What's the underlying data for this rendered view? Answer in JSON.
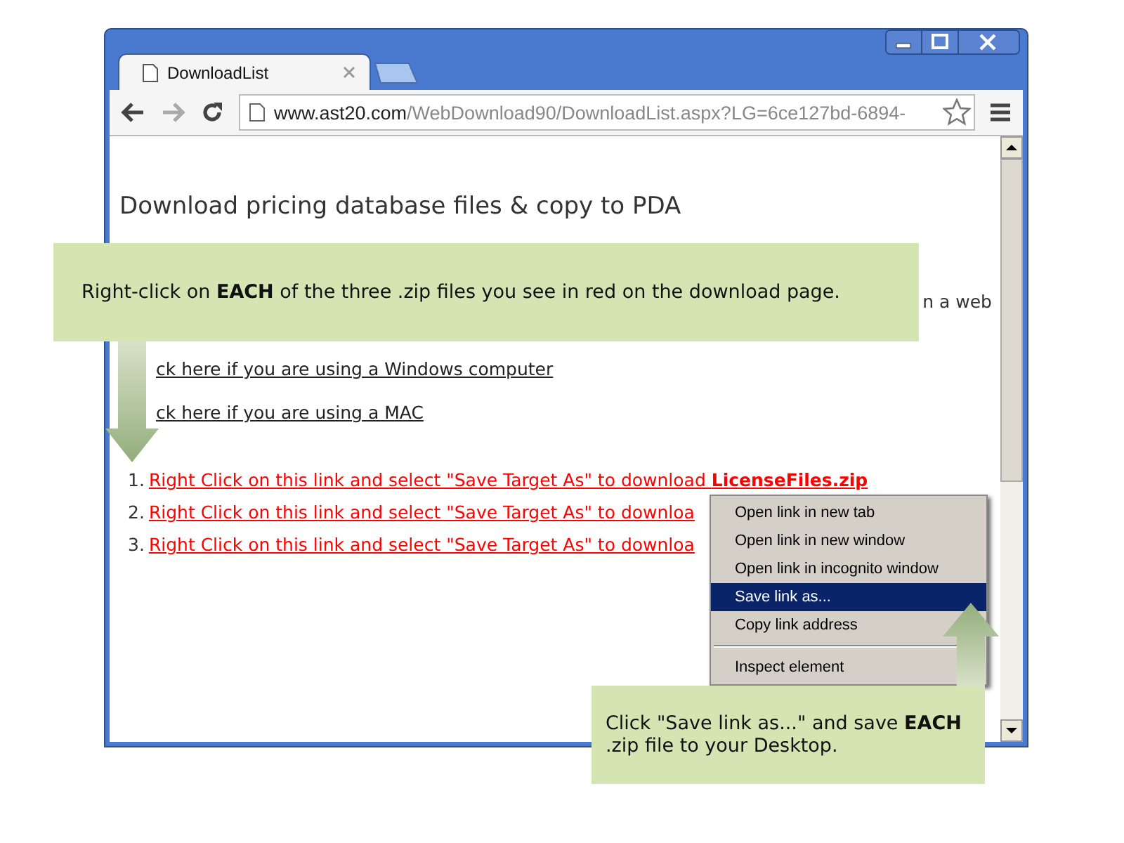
{
  "tab": {
    "title": "DownloadList"
  },
  "address": {
    "host": "www.ast20.com",
    "path": "/WebDownload90/DownloadList.aspx?LG=6ce127bd-6894-"
  },
  "page": {
    "heading": "Download pricing database files & copy to PDA",
    "partial_text": "n a web",
    "links": [
      "ck here if you are using a Windows computer",
      "ck here if you are using a MAC"
    ],
    "downloads": [
      {
        "number": "1.",
        "text": "Right Click on this link and select \"Save Target As\" to download **LicenseFiles.zip**"
      },
      {
        "number": "2.",
        "text": "Right Click on this link and select \"Save Target As\" to downloa"
      },
      {
        "number": "3.",
        "text": "Right Click on this link and select \"Save Target As\" to downloa"
      }
    ]
  },
  "context_menu": [
    {
      "label": "Open link in new tab",
      "selected": false,
      "divider_above": false
    },
    {
      "label": "Open link in new window",
      "selected": false,
      "divider_above": false
    },
    {
      "label": "Open link in incognito window",
      "selected": false,
      "divider_above": false
    },
    {
      "label": "Save link as...",
      "selected": true,
      "divider_above": false
    },
    {
      "label": "Copy link address",
      "selected": false,
      "divider_above": false
    },
    {
      "label": "Inspect element",
      "selected": false,
      "divider_above": true
    }
  ],
  "callouts": [
    {
      "text": "Right-click on **EACH** of the three .zip files you see in red on the download page.",
      "kind": "top"
    },
    {
      "text": "Click \"Save link as...\" and save **EACH** .zip file to your Desktop.",
      "kind": "bottom"
    }
  ]
}
